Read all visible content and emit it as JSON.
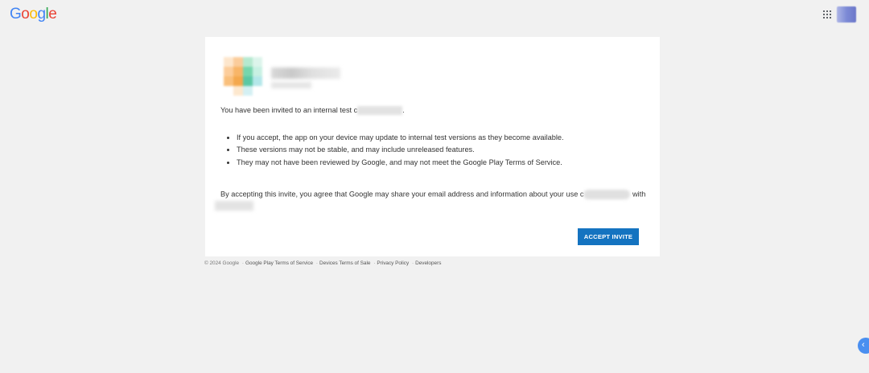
{
  "header": {
    "logo_text": "Google",
    "logo_letters": [
      {
        "ch": "G",
        "color": "#4285F4"
      },
      {
        "ch": "o",
        "color": "#EA4335"
      },
      {
        "ch": "o",
        "color": "#FBBC05"
      },
      {
        "ch": "g",
        "color": "#4285F4"
      },
      {
        "ch": "l",
        "color": "#34A853"
      },
      {
        "ch": "e",
        "color": "#EA4335"
      }
    ],
    "apps_icon": "apps-grid-icon",
    "avatar_icon": "account-avatar"
  },
  "card": {
    "invite_text_before": "You have been invited to an internal test c",
    "invite_text_after": ".",
    "bullets": [
      "If you accept, the app on your device may update to internal test versions as they become available.",
      "These versions may not be stable, and may include unreleased features.",
      "They may not have been reviewed by Google, and may not meet the Google Play Terms of Service."
    ],
    "agree_text_before": "By accepting this invite, you agree that Google may share your email address and information about your use c",
    "agree_text_after": " with",
    "accept_button": "ACCEPT INVITE",
    "accent_color": "#1473c0"
  },
  "footer": {
    "copyright": "© 2024 Google",
    "links": [
      "Google Play Terms of Service",
      "Devices Terms of Sale",
      "Privacy Policy",
      "Developers"
    ]
  },
  "side_button": {
    "icon": "chevron-left-icon",
    "glyph": "‹"
  }
}
